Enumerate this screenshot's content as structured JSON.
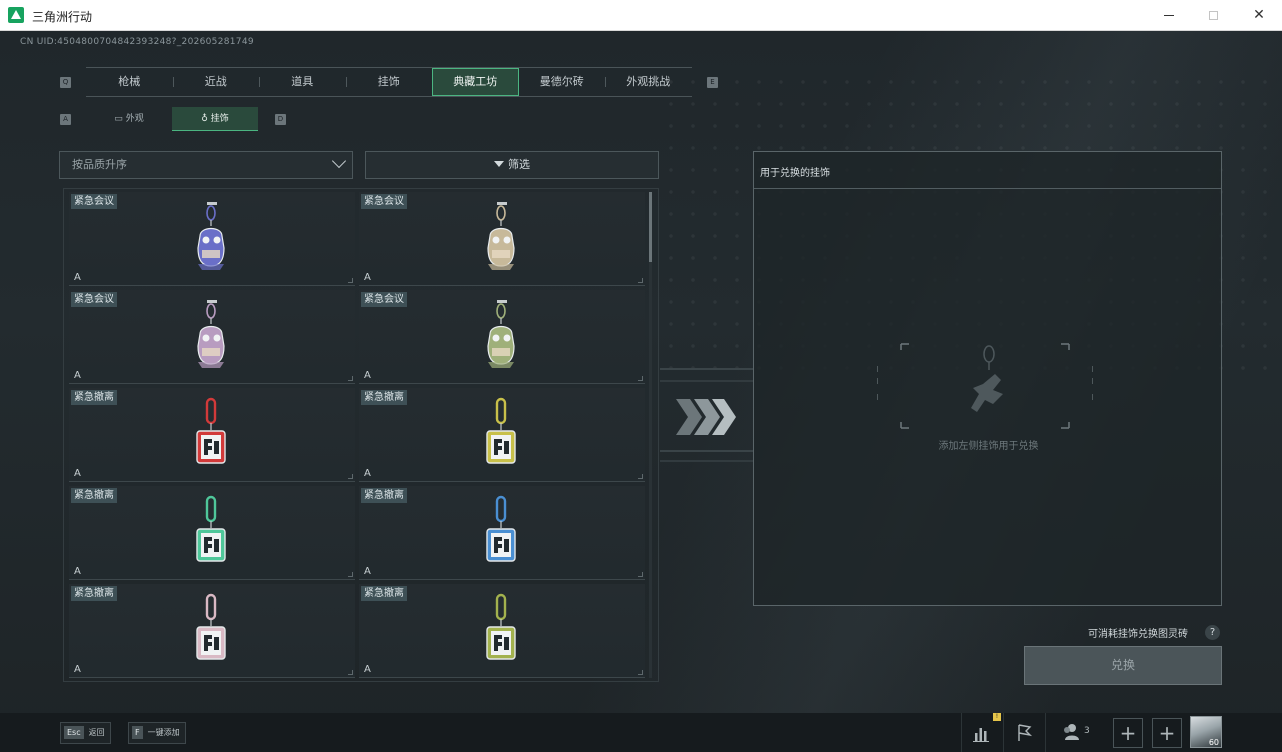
{
  "window": {
    "title": "三角洲行动",
    "minimize": "—",
    "maximize": "□",
    "close": "✕"
  },
  "uid": "CN UID:4504800704842393248?_202605281749",
  "top_tabs": [
    "枪械",
    "近战",
    "道具",
    "挂饰",
    "典藏工坊",
    "曼德尔砖",
    "外观挑战"
  ],
  "top_tabs_active": 4,
  "tab_hints": {
    "left": "Q",
    "right": "E"
  },
  "sub_tabs": [
    {
      "icon": "screen-icon",
      "label": "外观"
    },
    {
      "icon": "charm-icon",
      "label": "挂饰"
    }
  ],
  "sub_tabs_active": 1,
  "sub_hints": {
    "left": "A",
    "right": "D"
  },
  "sort": {
    "value": "按品质升序"
  },
  "filter": {
    "label": "筛选"
  },
  "items": [
    {
      "tag": "紧急会议",
      "grade": "A",
      "style": "meeting",
      "color": "#6a6fc8"
    },
    {
      "tag": "紧急会议",
      "grade": "A",
      "style": "meeting",
      "color": "#c7b99a"
    },
    {
      "tag": "紧急会议",
      "grade": "A",
      "style": "meeting",
      "color": "#b89cc0"
    },
    {
      "tag": "紧急会议",
      "grade": "A",
      "style": "meeting",
      "color": "#9fb07a"
    },
    {
      "tag": "紧急撤离",
      "grade": "A",
      "style": "evac",
      "color": "#d23a3a"
    },
    {
      "tag": "紧急撤离",
      "grade": "A",
      "style": "evac",
      "color": "#c8c04a"
    },
    {
      "tag": "紧急撤离",
      "grade": "A",
      "style": "evac",
      "color": "#4fc79a"
    },
    {
      "tag": "紧急撤离",
      "grade": "A",
      "style": "evac",
      "color": "#4a8fd2"
    },
    {
      "tag": "紧急撤离",
      "grade": "A",
      "style": "evac",
      "color": "#d9b9c4"
    },
    {
      "tag": "紧急撤离",
      "grade": "A",
      "style": "evac",
      "color": "#a3b24e"
    }
  ],
  "panel": {
    "title": "用于兑换的挂饰",
    "hint": "添加左侧挂饰用于兑换"
  },
  "consume_label": "可消耗挂饰兑换图灵砖",
  "help": "?",
  "exchange_button": "兑换",
  "bottom": {
    "esc_key": "Esc",
    "esc_label": "返回",
    "f_key": "F",
    "f_label": "一键添加",
    "notify": "!",
    "team_count": "3",
    "plus": "+",
    "level": "60"
  }
}
